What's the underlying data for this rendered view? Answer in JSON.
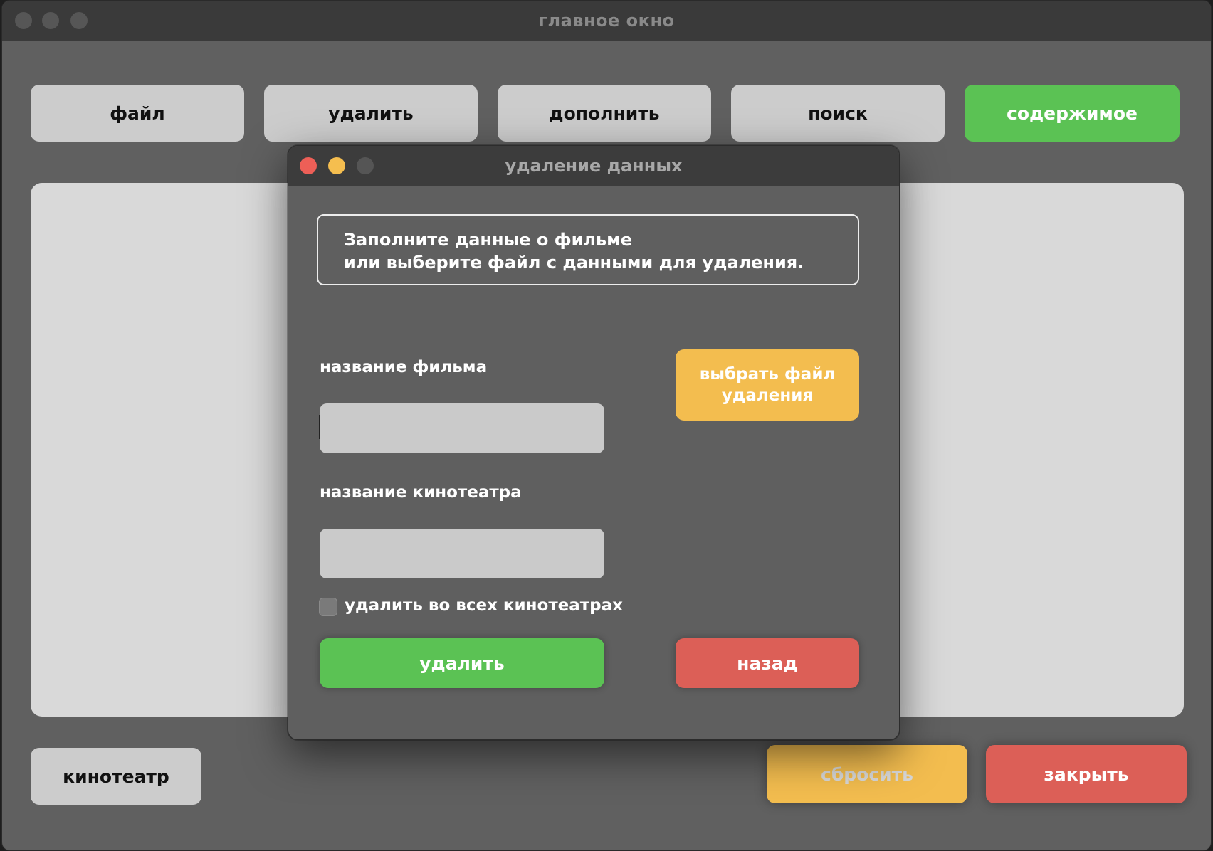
{
  "main_window": {
    "title": "главное окно",
    "toolbar": {
      "file_label": "файл",
      "delete_label": "удалить",
      "add_label": "дополнить",
      "search_label": "поиск",
      "contents_label": "содержимое"
    },
    "footer": {
      "cinema_label": "кинотеатр",
      "reset_label": "сбросить",
      "close_label": "закрыть"
    }
  },
  "dialog": {
    "title": "удаление данных",
    "info_line1": "Заполните данные о фильме",
    "info_line2": "или выберите файл с данными для удаления.",
    "film_name_label": "название фильма",
    "film_name_value": "",
    "cinema_name_label": "название кинотеатра",
    "cinema_name_value": "",
    "choose_file_line1": "выбрать файл",
    "choose_file_line2": "удаления",
    "delete_all_label": "удалить во всех кинотеатрах",
    "delete_all_checked": false,
    "delete_button_label": "удалить",
    "back_button_label": "назад"
  },
  "colors": {
    "green": "#5bc254",
    "yellow": "#f3bd4f",
    "red": "#dc5f57",
    "gray_button": "#cccccc",
    "window_bg": "#606060",
    "traffic_red": "#ed5f57",
    "traffic_yellow": "#f5be4f",
    "traffic_inactive": "#555555"
  }
}
